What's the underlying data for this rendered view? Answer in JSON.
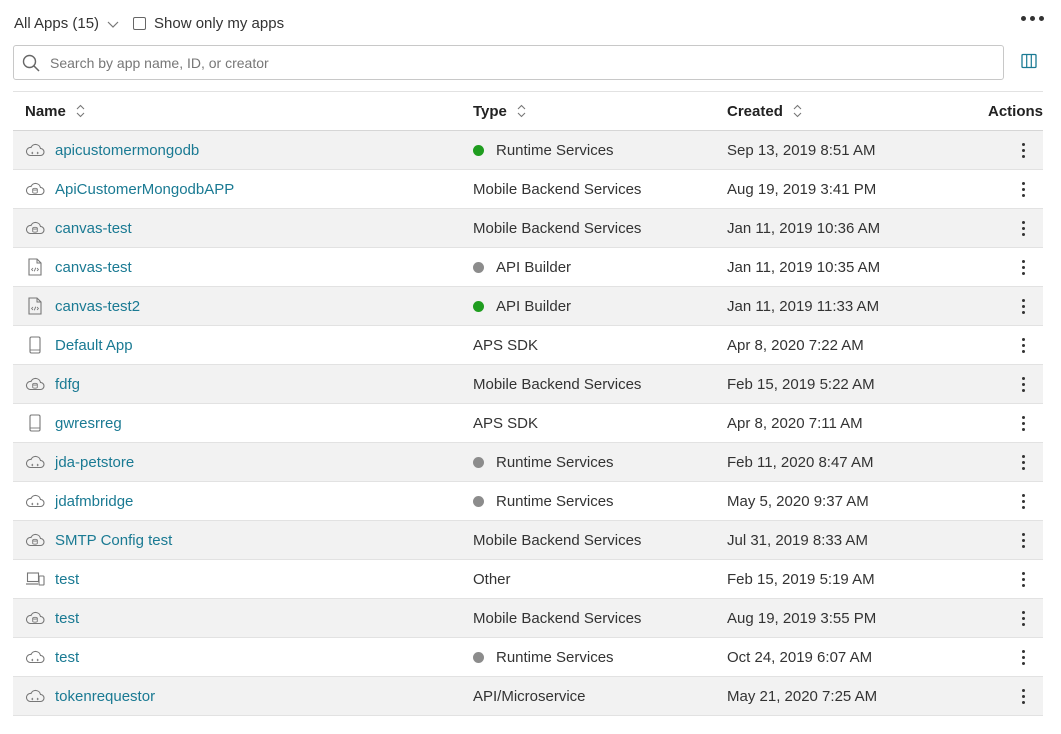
{
  "toolbar": {
    "filter_label": "All Apps (15)",
    "show_mine_label": "Show only my apps",
    "search_placeholder": "Search by app name, ID, or creator"
  },
  "columns": {
    "name": "Name",
    "type": "Type",
    "created": "Created",
    "actions": "Actions"
  },
  "status_colors": {
    "green": "#1f9d1f",
    "gray": "#8c8c8c"
  },
  "rows": [
    {
      "icon": "cloud-icon",
      "name": "apicustomermongodb",
      "type": "Runtime Services",
      "status": "green",
      "created": "Sep 13, 2019 8:51 AM"
    },
    {
      "icon": "cloud-db-icon",
      "name": "ApiCustomerMongodbAPP",
      "type": "Mobile Backend Services",
      "status": "",
      "created": "Aug 19, 2019 3:41 PM"
    },
    {
      "icon": "cloud-db-icon",
      "name": "canvas-test",
      "type": "Mobile Backend Services",
      "status": "",
      "created": "Jan 11, 2019 10:36 AM"
    },
    {
      "icon": "code-file-icon",
      "name": "canvas-test",
      "type": "API Builder",
      "status": "gray",
      "created": "Jan 11, 2019 10:35 AM"
    },
    {
      "icon": "code-file-icon",
      "name": "canvas-test2",
      "type": "API Builder",
      "status": "green",
      "created": "Jan 11, 2019 11:33 AM"
    },
    {
      "icon": "phone-icon",
      "name": "Default App",
      "type": "APS SDK",
      "status": "",
      "created": "Apr 8, 2020 7:22 AM"
    },
    {
      "icon": "cloud-db-icon",
      "name": "fdfg",
      "type": "Mobile Backend Services",
      "status": "",
      "created": "Feb 15, 2019 5:22 AM"
    },
    {
      "icon": "phone-icon",
      "name": "gwresrreg",
      "type": "APS SDK",
      "status": "",
      "created": "Apr 8, 2020 7:11 AM"
    },
    {
      "icon": "cloud-icon",
      "name": "jda-petstore",
      "type": "Runtime Services",
      "status": "gray",
      "created": "Feb 11, 2020 8:47 AM"
    },
    {
      "icon": "cloud-icon",
      "name": "jdafmbridge",
      "type": "Runtime Services",
      "status": "gray",
      "created": "May 5, 2020 9:37 AM"
    },
    {
      "icon": "cloud-db-icon",
      "name": "SMTP Config test",
      "type": "Mobile Backend Services",
      "status": "",
      "created": "Jul 31, 2019 8:33 AM"
    },
    {
      "icon": "devices-icon",
      "name": "test",
      "type": "Other",
      "status": "",
      "created": "Feb 15, 2019 5:19 AM"
    },
    {
      "icon": "cloud-db-icon",
      "name": "test",
      "type": "Mobile Backend Services",
      "status": "",
      "created": "Aug 19, 2019 3:55 PM"
    },
    {
      "icon": "cloud-icon",
      "name": "test",
      "type": "Runtime Services",
      "status": "gray",
      "created": "Oct 24, 2019 6:07 AM"
    },
    {
      "icon": "cloud-icon",
      "name": "tokenrequestor",
      "type": "API/Microservice",
      "status": "",
      "created": "May 21, 2020 7:25 AM"
    }
  ]
}
